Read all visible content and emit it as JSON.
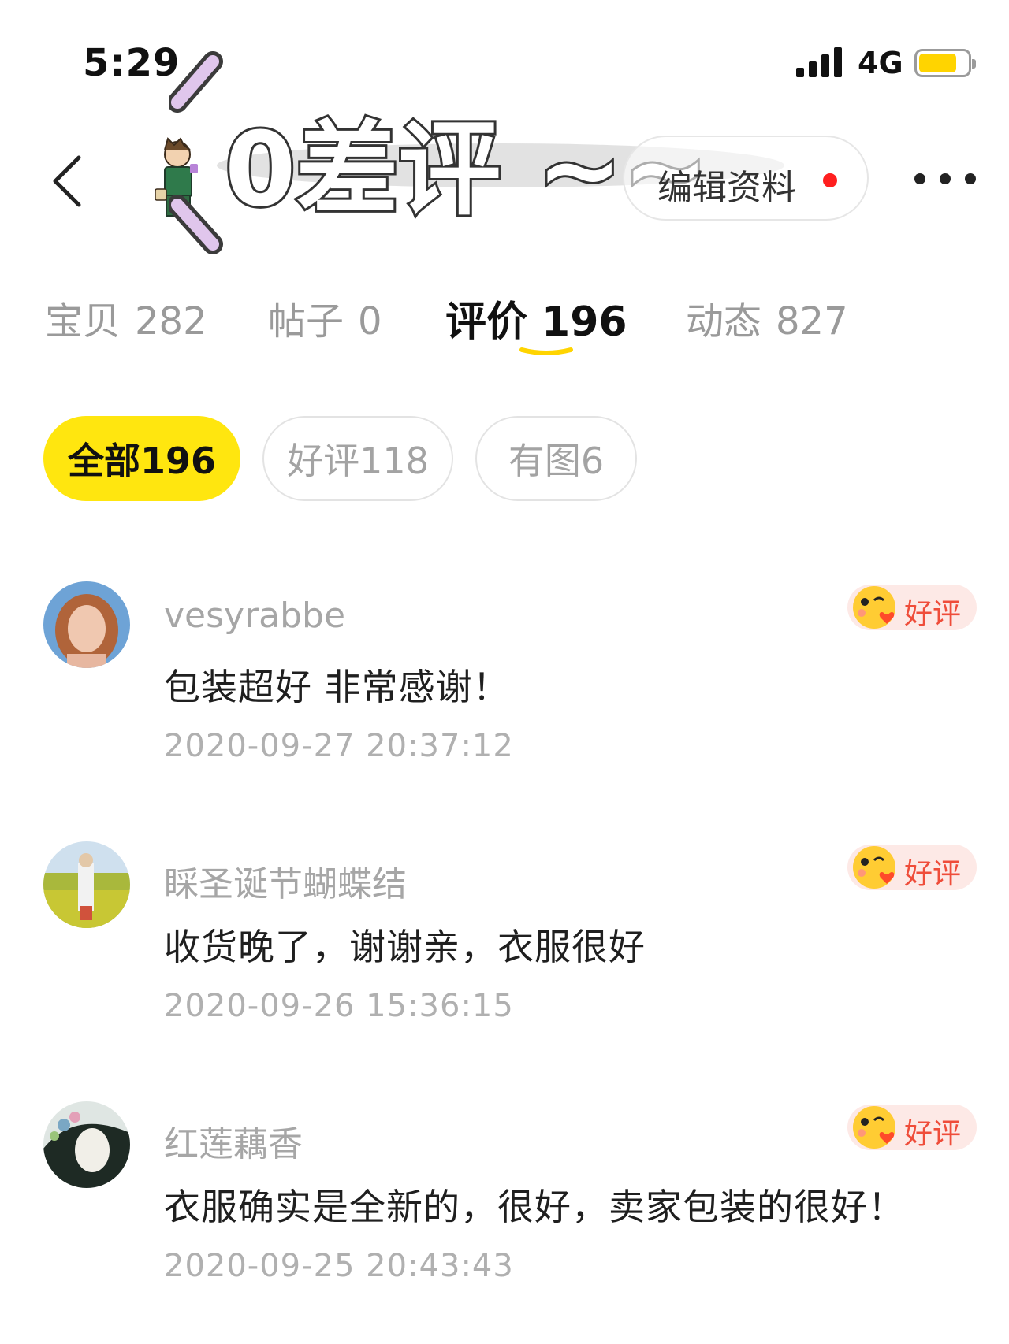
{
  "status_bar": {
    "time": "5:29",
    "network": "4G",
    "battery_level": 0.78
  },
  "nav": {
    "edit_label": "编辑资料",
    "sticker_text": "0差评 ~~",
    "accent_color": "#ffe60f"
  },
  "tabs": [
    {
      "label": "宝贝",
      "count": "282"
    },
    {
      "label": "帖子",
      "count": "0"
    },
    {
      "label": "评价",
      "count": "196"
    },
    {
      "label": "动态",
      "count": "827"
    }
  ],
  "filters": [
    {
      "label": "全部196"
    },
    {
      "label": "好评118"
    },
    {
      "label": "有图6"
    }
  ],
  "reviews": [
    {
      "name": "vesyrabbe",
      "comment": "包装超好 非常感谢！",
      "time": "2020-09-27 20:37:12",
      "badge": "好评"
    },
    {
      "name": "睬圣诞节蝴蝶结",
      "comment": "收货晚了，谢谢亲，衣服很好",
      "time": "2020-09-26 15:36:15",
      "badge": "好评"
    },
    {
      "name": "红莲藕香",
      "comment": "衣服确实是全新的，很好，卖家包装的很好！",
      "time": "2020-09-25 20:43:43",
      "badge": "好评"
    }
  ]
}
